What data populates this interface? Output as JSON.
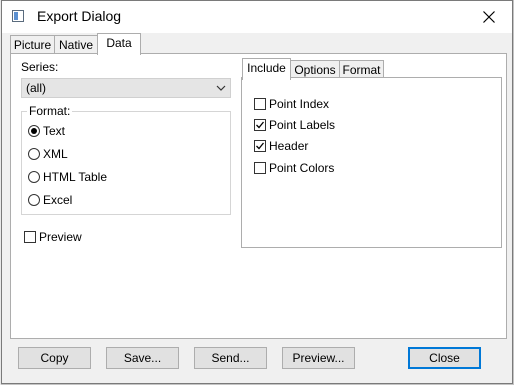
{
  "window": {
    "title": "Export Dialog"
  },
  "outer_tabs": [
    "Picture",
    "Native",
    "Data"
  ],
  "series": {
    "label": "Series:",
    "value": "(all)"
  },
  "format": {
    "label": "Format:",
    "options": [
      "Text",
      "XML",
      "HTML Table",
      "Excel"
    ],
    "selected": "Text"
  },
  "preview_checkbox": {
    "label": "Preview",
    "checked": false
  },
  "inner_tabs": [
    "Include",
    "Options",
    "Format"
  ],
  "include": [
    {
      "label": "Point Index",
      "checked": false
    },
    {
      "label": "Point Labels",
      "checked": true
    },
    {
      "label": "Header",
      "checked": true
    },
    {
      "label": "Point Colors",
      "checked": false
    }
  ],
  "buttons": {
    "copy": "Copy",
    "save": "Save...",
    "send": "Send...",
    "preview": "Preview...",
    "close": "Close"
  }
}
